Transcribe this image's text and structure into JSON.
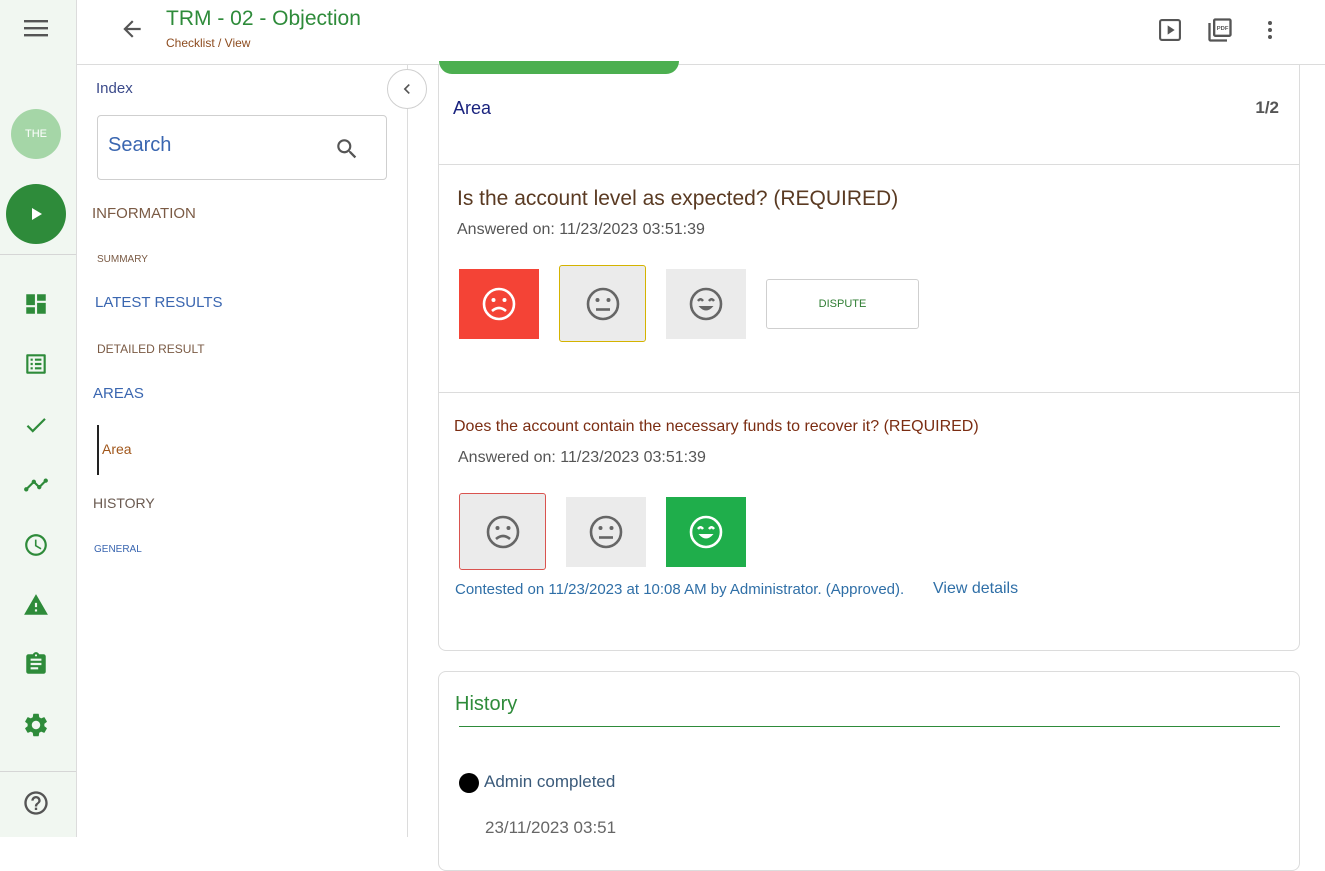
{
  "rail": {
    "avatar_text": "THE",
    "icons": [
      "menu-icon",
      "play-icon",
      "dashboard-icon",
      "list-icon",
      "check-icon",
      "trend-icon",
      "clock-icon",
      "warning-icon",
      "clipboard-icon",
      "gear-icon",
      "help-icon"
    ]
  },
  "header": {
    "title": "TRM - 02 - Objection",
    "breadcrumb": "Checklist / View"
  },
  "index": {
    "label": "Index",
    "search_placeholder": "Search",
    "items": [
      {
        "label": "INFORMATION"
      },
      {
        "label": "SUMMARY"
      },
      {
        "label": "LATEST RESULTS"
      },
      {
        "label": "DETAILED RESULT"
      },
      {
        "label": "AREAS"
      },
      {
        "label": "Area"
      },
      {
        "label": "HISTORY"
      },
      {
        "label": "GENERAL"
      }
    ]
  },
  "main": {
    "area_title": "Area",
    "pager": "1/2",
    "q1": {
      "text": "Is the account level as expected? (REQUIRED)",
      "answered": "Answered on: 11/23/2023 03:51:39",
      "dispute_label": "DISPUTE"
    },
    "q2": {
      "text": "Does the account contain the necessary funds to recover it? (REQUIRED)",
      "answered": "Answered on: 11/23/2023 03:51:39",
      "contested": "Contested on 11/23/2023 at 10:08 AM by Administrator. (Approved).",
      "view_details": "View details"
    },
    "history": {
      "title": "History",
      "event": "Admin completed",
      "timestamp": "23/11/2023 03:51"
    }
  },
  "colors": {
    "brand_green": "#2e8b3a",
    "sad_red": "#f44336",
    "happy_green": "#1fae4b",
    "selected_border_yellow": "#d4b300",
    "contested_border_red": "#d9534f"
  }
}
